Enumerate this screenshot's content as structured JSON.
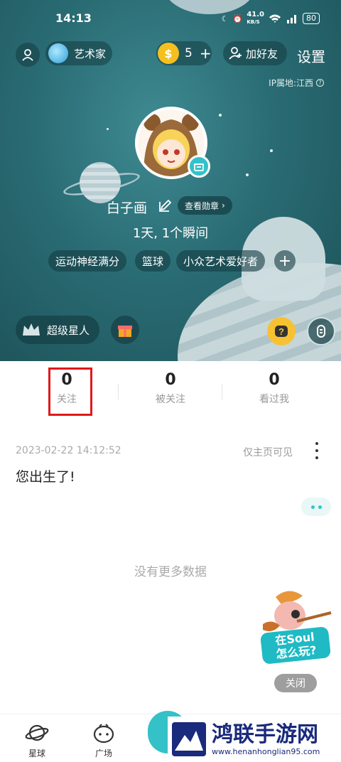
{
  "status_bar": {
    "time": "14:13",
    "network_speed": "41.0",
    "network_unit": "KB/S",
    "battery": "80"
  },
  "header": {
    "artist_label": "艺术家",
    "coins": "5",
    "add_friend_label": "加好友",
    "settings_label": "设置",
    "ip_location": "IP属地:江西"
  },
  "profile": {
    "name": "白子画",
    "medal_button": "查看勋章",
    "summary": "1天, 1个瞬间",
    "tags": [
      "运动神经满分",
      "篮球",
      "小众艺术爱好者"
    ]
  },
  "actions": {
    "super_star_label": "超级星人"
  },
  "counts": [
    {
      "value": "0",
      "label": "关注"
    },
    {
      "value": "0",
      "label": "被关注"
    },
    {
      "value": "0",
      "label": "看过我"
    }
  ],
  "post": {
    "date": "2023-02-22 14:12:52",
    "visibility": "仅主页可见",
    "text": "您出生了!"
  },
  "empty_text": "没有更多数据",
  "mascot": {
    "line1": "在Soul",
    "line2": "怎么玩?",
    "close_label": "关闭"
  },
  "tabs": [
    {
      "label": "星球"
    },
    {
      "label": "广场"
    }
  ],
  "watermark": {
    "title": "鸿联手游网",
    "url": "www.henanhonglian95.com"
  },
  "colors": {
    "accent": "#2fc6cd",
    "highlight_box": "#e0191b",
    "hero_bg": "#2a6c74"
  }
}
